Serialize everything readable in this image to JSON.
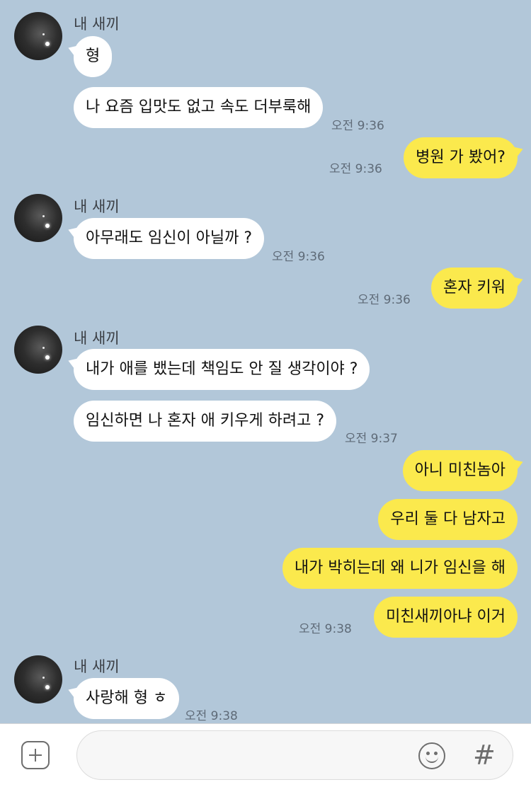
{
  "contact": {
    "name": "내 새끼"
  },
  "messages": [
    {
      "text": "형"
    },
    {
      "text": "나 요즘 입맛도 없고 속도 더부룩해",
      "time": "오전 9:36"
    },
    {
      "text": "병원 가 봤어?",
      "time": "오전 9:36"
    },
    {
      "text": "아무래도 임신이 아닐까 ?",
      "time": "오전 9:36"
    },
    {
      "text": "혼자 키워",
      "time": "오전 9:36"
    },
    {
      "text": "내가 애를 뱄는데 책임도 안 질 생각이야 ?"
    },
    {
      "text": "임신하면 나 혼자 애 키우게 하려고 ?",
      "time": "오전 9:37"
    },
    {
      "text": "아니 미친놈아"
    },
    {
      "text": "우리 둘 다 남자고"
    },
    {
      "text": "내가 박히는데 왜 니가 임신을 해"
    },
    {
      "text": "미친새끼아냐 이거",
      "time": "오전 9:38"
    },
    {
      "text": "사랑해 형 ㅎ",
      "time": "오전 9:38"
    }
  ],
  "input": {
    "placeholder": ""
  },
  "icons": {
    "attach": "plus-icon",
    "emoji": "emoji-icon",
    "hash": "hash-icon"
  },
  "colors": {
    "background": "#b2c7d9",
    "incoming": "#ffffff",
    "outgoing": "#fbe94d"
  }
}
